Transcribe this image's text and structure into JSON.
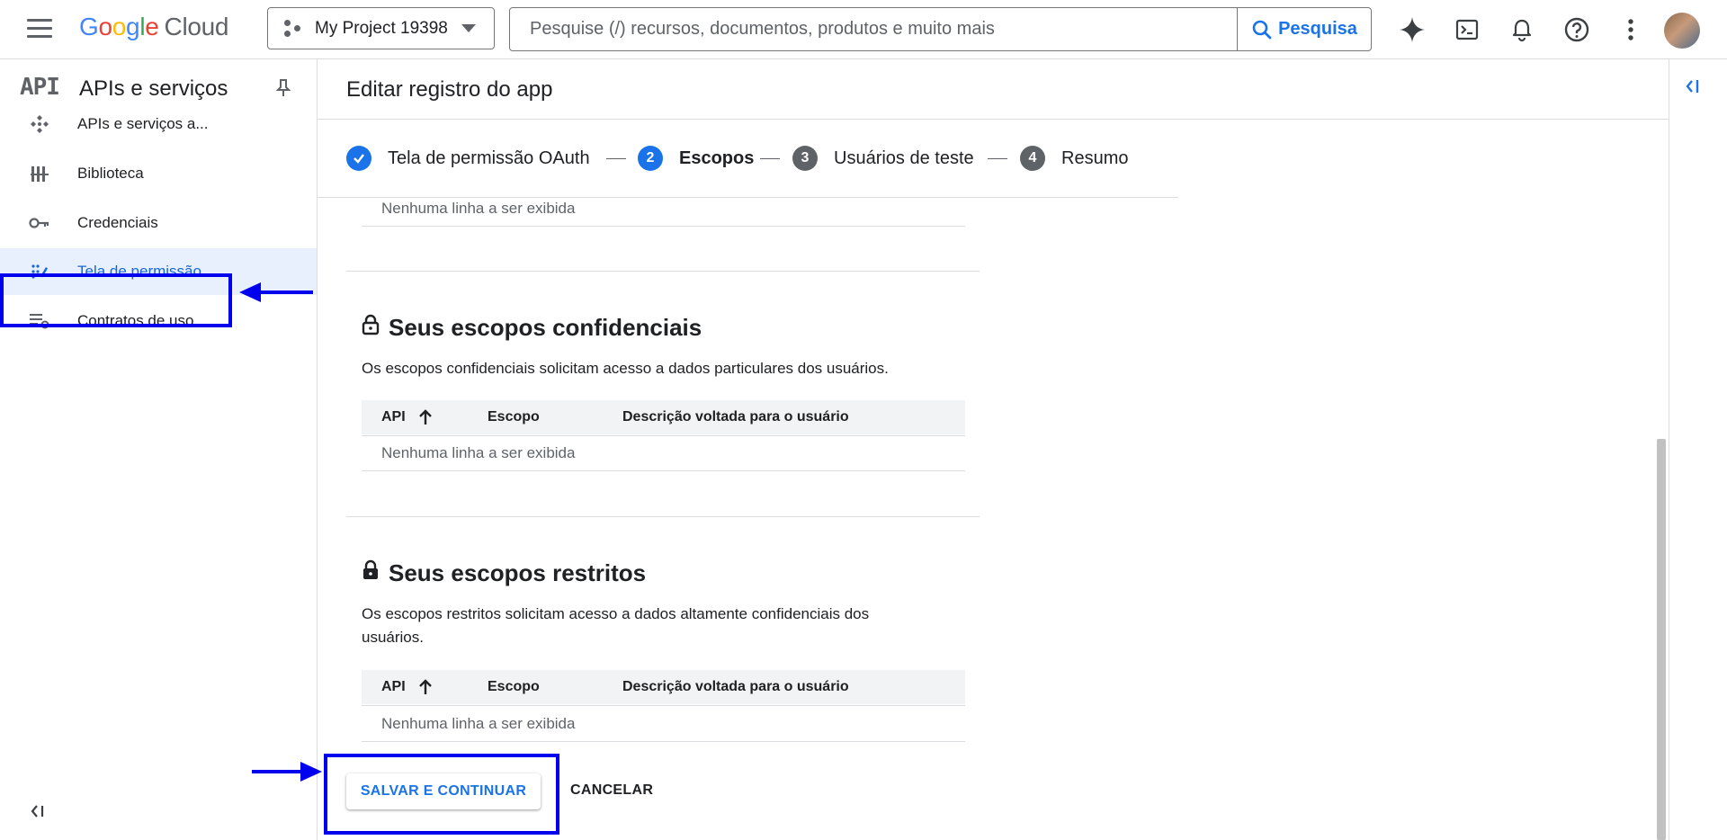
{
  "header": {
    "logo_google": "Google",
    "logo_cloud": "Cloud",
    "project_name": "My Project 19398",
    "search_placeholder": "Pesquise (/) recursos, documentos, produtos e muito mais",
    "search_button": "Pesquisa",
    "icons": [
      "menu-icon",
      "gemini-sparkle-icon",
      "cloud-shell-icon",
      "notifications-icon",
      "help-icon",
      "more-vert-icon"
    ]
  },
  "sidenav": {
    "logo_text": "API",
    "title": "APIs e serviços",
    "items": [
      {
        "label": "APIs e serviços a...",
        "icon": "apis-icon",
        "active": false
      },
      {
        "label": "Biblioteca",
        "icon": "library-icon",
        "active": false
      },
      {
        "label": "Credenciais",
        "icon": "key-icon",
        "active": false
      },
      {
        "label": "Tela de permissão...",
        "icon": "consent-screen-icon",
        "active": true
      },
      {
        "label": "Contratos de uso...",
        "icon": "agreements-icon",
        "active": false
      }
    ]
  },
  "page": {
    "title": "Editar registro do app",
    "steps": [
      {
        "label": "Tela de permissão OAuth",
        "state": "done"
      },
      {
        "num": "2",
        "label": "Escopos",
        "state": "current"
      },
      {
        "num": "3",
        "label": "Usuários de teste",
        "state": "pending"
      },
      {
        "num": "4",
        "label": "Resumo",
        "state": "pending"
      }
    ]
  },
  "content": {
    "top_empty": "Nenhuma linha a ser exibida",
    "confidential": {
      "title": "Seus escopos confidenciais",
      "desc": "Os escopos confidenciais solicitam acesso a dados particulares dos usuários.",
      "columns": [
        "API",
        "Escopo",
        "Descrição voltada para o usuário"
      ],
      "empty": "Nenhuma linha a ser exibida"
    },
    "restricted": {
      "title": "Seus escopos restritos",
      "desc": "Os escopos restritos solicitam acesso a dados altamente confidenciais dos usuários.",
      "columns": [
        "API",
        "Escopo",
        "Descrição voltada para o usuário"
      ],
      "empty": "Nenhuma linha a ser exibida"
    }
  },
  "actions": {
    "save": "SALVAR E CONTINUAR",
    "cancel": "CANCELAR"
  },
  "annotation_color": "#0000ee"
}
